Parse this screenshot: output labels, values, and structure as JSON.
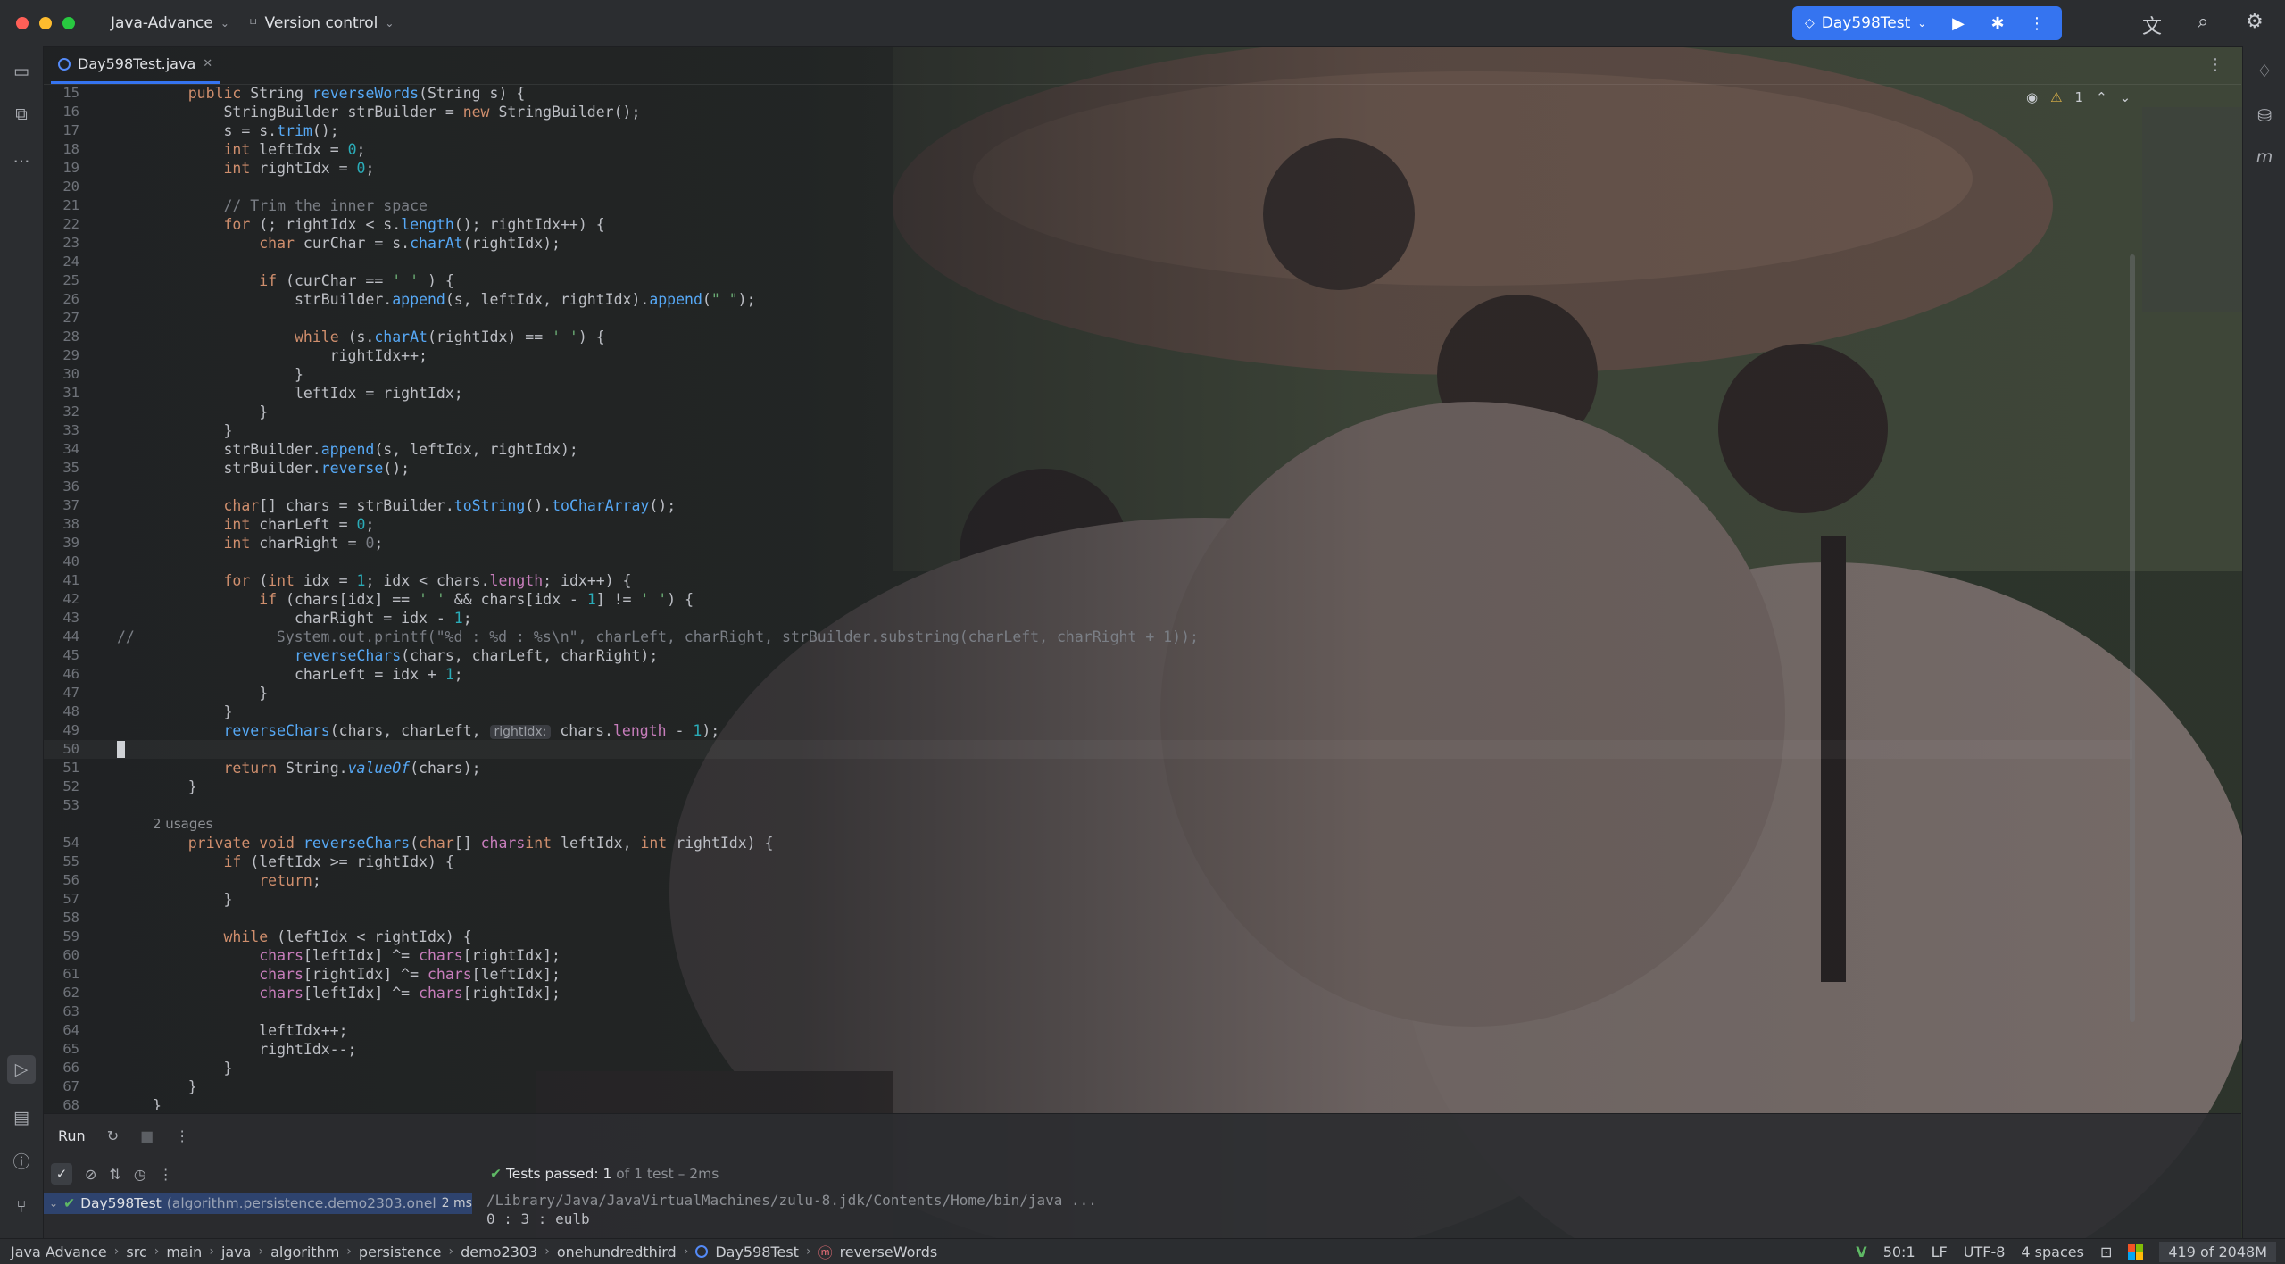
{
  "window": {
    "project": "Java-Advance",
    "version_control": "Version control",
    "run_config": "Day598Test"
  },
  "tab": {
    "file": "Day598Test.java"
  },
  "editor": {
    "lines": [
      {
        "n": "15",
        "segs": [
          [
            "",
            "    "
          ],
          [
            "kw",
            "public "
          ],
          [
            "",
            "String "
          ],
          [
            "fn",
            "reverseWords"
          ],
          [
            "",
            "(String s) {"
          ]
        ]
      },
      {
        "n": "16",
        "segs": [
          [
            "",
            "        StringBuilder strBuilder = "
          ],
          [
            "kw",
            "new "
          ],
          [
            "",
            "StringBuilder();"
          ]
        ]
      },
      {
        "n": "17",
        "segs": [
          [
            "",
            "        s = s."
          ],
          [
            "fn",
            "trim"
          ],
          [
            "",
            "();"
          ]
        ]
      },
      {
        "n": "18",
        "segs": [
          [
            "",
            "        "
          ],
          [
            "kw",
            "int "
          ],
          [
            "",
            "leftIdx = "
          ],
          [
            "num",
            "0"
          ],
          [
            "",
            ";"
          ]
        ]
      },
      {
        "n": "19",
        "segs": [
          [
            "",
            "        "
          ],
          [
            "kw",
            "int "
          ],
          [
            "",
            "rightIdx = "
          ],
          [
            "num",
            "0"
          ],
          [
            "",
            ";"
          ]
        ]
      },
      {
        "n": "20",
        "segs": []
      },
      {
        "n": "21",
        "segs": [
          [
            "cm",
            "        // Trim the inner space"
          ]
        ]
      },
      {
        "n": "22",
        "segs": [
          [
            "",
            "        "
          ],
          [
            "kw",
            "for "
          ],
          [
            "",
            "(; rightIdx < s."
          ],
          [
            "fn",
            "length"
          ],
          [
            "",
            "(); rightIdx++) {"
          ]
        ]
      },
      {
        "n": "23",
        "segs": [
          [
            "",
            "            "
          ],
          [
            "kw",
            "char "
          ],
          [
            "",
            "curChar = s."
          ],
          [
            "fn",
            "charAt"
          ],
          [
            "",
            "(rightIdx);"
          ]
        ]
      },
      {
        "n": "24",
        "segs": []
      },
      {
        "n": "25",
        "segs": [
          [
            "",
            "            "
          ],
          [
            "kw",
            "if "
          ],
          [
            "",
            "(curChar == "
          ],
          [
            "str",
            "' '"
          ],
          [
            "",
            " ) {"
          ]
        ]
      },
      {
        "n": "26",
        "segs": [
          [
            "",
            "                strBuilder."
          ],
          [
            "fn",
            "append"
          ],
          [
            "",
            "(s, leftIdx, rightIdx)."
          ],
          [
            "fn",
            "append"
          ],
          [
            "",
            "("
          ],
          [
            "str",
            "\" \""
          ],
          [
            "",
            ");"
          ]
        ]
      },
      {
        "n": "27",
        "segs": []
      },
      {
        "n": "28",
        "segs": [
          [
            "",
            "                "
          ],
          [
            "kw",
            "while "
          ],
          [
            "",
            "(s."
          ],
          [
            "fn",
            "charAt"
          ],
          [
            "",
            "(rightIdx) == "
          ],
          [
            "str",
            "' '"
          ],
          [
            "",
            ") {"
          ]
        ]
      },
      {
        "n": "29",
        "segs": [
          [
            "",
            "                    rightIdx++;"
          ]
        ]
      },
      {
        "n": "30",
        "segs": [
          [
            "",
            "                }"
          ]
        ]
      },
      {
        "n": "31",
        "segs": [
          [
            "",
            "                leftIdx = rightIdx;"
          ]
        ]
      },
      {
        "n": "32",
        "segs": [
          [
            "",
            "            }"
          ]
        ]
      },
      {
        "n": "33",
        "segs": [
          [
            "",
            "        }"
          ]
        ]
      },
      {
        "n": "34",
        "segs": [
          [
            "",
            "        strBuilder."
          ],
          [
            "fn",
            "append"
          ],
          [
            "",
            "(s, leftIdx, rightIdx);"
          ]
        ]
      },
      {
        "n": "35",
        "segs": [
          [
            "",
            "        strBuilder."
          ],
          [
            "fn",
            "reverse"
          ],
          [
            "",
            "();"
          ]
        ]
      },
      {
        "n": "36",
        "segs": []
      },
      {
        "n": "37",
        "segs": [
          [
            "",
            "        "
          ],
          [
            "kw",
            "char"
          ],
          [
            "",
            "[] chars = strBuilder."
          ],
          [
            "fn",
            "toString"
          ],
          [
            "",
            "()."
          ],
          [
            "fn",
            "toCharArray"
          ],
          [
            "",
            "();"
          ]
        ]
      },
      {
        "n": "38",
        "segs": [
          [
            "",
            "        "
          ],
          [
            "kw",
            "int "
          ],
          [
            "",
            "charLeft = "
          ],
          [
            "num",
            "0"
          ],
          [
            "",
            ";"
          ]
        ]
      },
      {
        "n": "39",
        "segs": [
          [
            "",
            "        "
          ],
          [
            "kw",
            "int "
          ],
          [
            "",
            "charRight = "
          ],
          [
            "cm",
            "0"
          ],
          [
            "",
            ";"
          ]
        ]
      },
      {
        "n": "40",
        "segs": []
      },
      {
        "n": "41",
        "segs": [
          [
            "",
            "        "
          ],
          [
            "kw",
            "for "
          ],
          [
            "",
            "("
          ],
          [
            "kw",
            "int "
          ],
          [
            "",
            "idx = "
          ],
          [
            "num",
            "1"
          ],
          [
            "",
            "; idx < chars."
          ],
          [
            "fld",
            "length"
          ],
          [
            "",
            "; idx++) {"
          ]
        ]
      },
      {
        "n": "42",
        "segs": [
          [
            "",
            "            "
          ],
          [
            "kw",
            "if "
          ],
          [
            "",
            "(chars[idx] == "
          ],
          [
            "str",
            "' '"
          ],
          [
            "",
            " && chars[idx - "
          ],
          [
            "num",
            "1"
          ],
          [
            "",
            "] != "
          ],
          [
            "str",
            "' '"
          ],
          [
            "",
            ") {"
          ]
        ]
      },
      {
        "n": "43",
        "segs": [
          [
            "",
            "                charRight = idx - "
          ],
          [
            "num",
            "1"
          ],
          [
            "",
            ";"
          ]
        ]
      },
      {
        "n": "44",
        "segs": [
          [
            "cm",
            "//                System.out.printf(\"%d : %d : %s\\n\", charLeft, charRight, strBuilder.substring(charLeft, charRight + 1));"
          ]
        ],
        "comment_prefix": true
      },
      {
        "n": "45",
        "segs": [
          [
            "",
            "                "
          ],
          [
            "fn",
            "reverseChars"
          ],
          [
            "",
            "(chars, charLeft, charRight);"
          ]
        ]
      },
      {
        "n": "46",
        "segs": [
          [
            "",
            "                charLeft = idx + "
          ],
          [
            "num",
            "1"
          ],
          [
            "",
            ";"
          ]
        ]
      },
      {
        "n": "47",
        "segs": [
          [
            "",
            "            }"
          ]
        ]
      },
      {
        "n": "48",
        "segs": [
          [
            "",
            "        }"
          ]
        ]
      },
      {
        "n": "49",
        "segs": [
          [
            "",
            "        "
          ],
          [
            "fn",
            "reverseChars"
          ],
          [
            "",
            "(chars, charLeft, "
          ],
          [
            "hint",
            "rightIdx:"
          ],
          [
            "",
            " chars."
          ],
          [
            "fld",
            "length"
          ],
          [
            "",
            " - "
          ],
          [
            "num",
            "1"
          ],
          [
            "",
            ");"
          ]
        ]
      },
      {
        "n": "50",
        "segs": [],
        "current": true
      },
      {
        "n": "51",
        "segs": [
          [
            "",
            "        "
          ],
          [
            "kw",
            "return "
          ],
          [
            "",
            "String."
          ],
          [
            "fn it",
            "valueOf"
          ],
          [
            "",
            "(chars);"
          ]
        ]
      },
      {
        "n": "52",
        "segs": [
          [
            "",
            "    }"
          ]
        ]
      },
      {
        "n": "53",
        "segs": []
      },
      {
        "n": "",
        "usage": "2 usages"
      },
      {
        "n": "54",
        "segs": [
          [
            "",
            "    "
          ],
          [
            "kw",
            "private void "
          ],
          [
            "fn",
            "reverseChars"
          ],
          [
            "",
            "("
          ],
          [
            "kw",
            "char"
          ],
          [
            "",
            "[] "
          ],
          [
            "fld",
            "chars"
          ],
          [
            ", "
          ],
          [
            "kw",
            "int "
          ],
          [
            "",
            "leftIdx, "
          ],
          [
            "kw",
            "int "
          ],
          [
            "",
            "rightIdx) {"
          ]
        ]
      },
      {
        "n": "55",
        "segs": [
          [
            "",
            "        "
          ],
          [
            "kw",
            "if "
          ],
          [
            "",
            "(leftIdx >= rightIdx) {"
          ]
        ]
      },
      {
        "n": "56",
        "segs": [
          [
            "",
            "            "
          ],
          [
            "kw",
            "return"
          ],
          [
            "",
            ";"
          ]
        ]
      },
      {
        "n": "57",
        "segs": [
          [
            "",
            "        }"
          ]
        ]
      },
      {
        "n": "58",
        "segs": []
      },
      {
        "n": "59",
        "segs": [
          [
            "",
            "        "
          ],
          [
            "kw",
            "while "
          ],
          [
            "",
            "(leftIdx < rightIdx) {"
          ]
        ]
      },
      {
        "n": "60",
        "segs": [
          [
            "",
            "            "
          ],
          [
            "fld",
            "chars"
          ],
          [
            "",
            "[leftIdx] ^= "
          ],
          [
            "fld",
            "chars"
          ],
          [
            "",
            "[rightIdx];"
          ]
        ]
      },
      {
        "n": "61",
        "segs": [
          [
            "",
            "            "
          ],
          [
            "fld",
            "chars"
          ],
          [
            "",
            "[rightIdx] ^= "
          ],
          [
            "fld",
            "chars"
          ],
          [
            "",
            "[leftIdx];"
          ]
        ]
      },
      {
        "n": "62",
        "segs": [
          [
            "",
            "            "
          ],
          [
            "fld",
            "chars"
          ],
          [
            "",
            "[leftIdx] ^= "
          ],
          [
            "fld",
            "chars"
          ],
          [
            "",
            "[rightIdx];"
          ]
        ]
      },
      {
        "n": "63",
        "segs": []
      },
      {
        "n": "64",
        "segs": [
          [
            "",
            "            leftIdx++;"
          ]
        ]
      },
      {
        "n": "65",
        "segs": [
          [
            "",
            "            rightIdx--;"
          ]
        ]
      },
      {
        "n": "66",
        "segs": [
          [
            "",
            "        }"
          ]
        ]
      },
      {
        "n": "67",
        "segs": [
          [
            "",
            "    }"
          ]
        ]
      },
      {
        "n": "68",
        "segs": [
          [
            "",
            "}"
          ]
        ]
      }
    ],
    "warnings": "1"
  },
  "run_panel": {
    "title": "Run",
    "tests_passed": "Tests passed: 1",
    "tests_detail": " of 1 test – 2ms",
    "test_name": "Day598Test",
    "test_package": "(algorithm.persistence.demo2303.onel",
    "test_time": "2 ms",
    "console_cmd": "/Library/Java/JavaVirtualMachines/zulu-8.jdk/Contents/Home/bin/java ...",
    "console_out": "0 : 3 : eulb"
  },
  "status_bar": {
    "breadcrumbs": [
      "Java Advance",
      "src",
      "main",
      "java",
      "algorithm",
      "persistence",
      "demo2303",
      "onehundredthird",
      "Day598Test",
      "reverseWords"
    ],
    "position": "50:1",
    "line_sep": "LF",
    "encoding": "UTF-8",
    "indent": "4 spaces",
    "memory": "419 of 2048M"
  },
  "colors": {
    "accent": "#3574f0",
    "pass": "#5fb865"
  }
}
